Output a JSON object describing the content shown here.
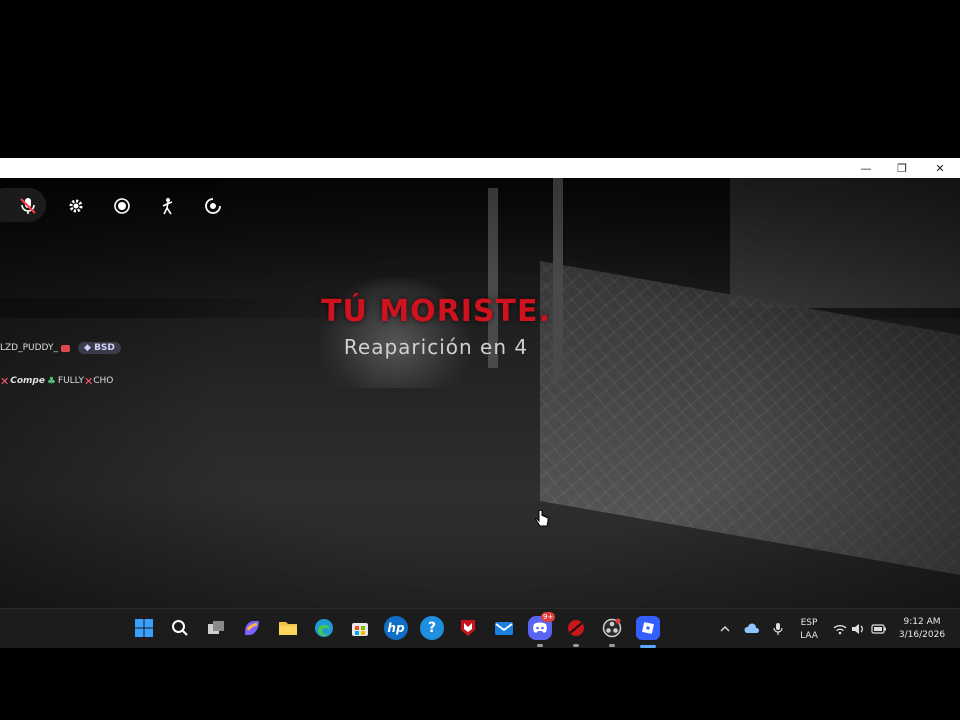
{
  "window": {
    "minimize_glyph": "—",
    "restore_glyph": "❐",
    "close_glyph": "✕"
  },
  "hud": {
    "icons": [
      "microphone-muted-icon",
      "gear-icon",
      "record-icon",
      "emote-icon",
      "backpack-icon"
    ]
  },
  "death_screen": {
    "title": "TÚ MORISTE.",
    "title_color": "#d0121f",
    "respawn_text": "Reaparición en 4"
  },
  "player_tags": [
    {
      "name": "LZD_PUDDY_",
      "badge": "BSD"
    },
    {
      "prefix": "Compe",
      "middle": "FULLY",
      "suffix": "CHO"
    }
  ],
  "taskbar": {
    "apps": [
      "start-icon",
      "search-icon",
      "task-view-icon",
      "copilot-icon",
      "file-explorer-icon",
      "edge-icon",
      "store-icon",
      "hp-icon",
      "help-icon",
      "mcafee-icon",
      "mail-icon",
      "discord-icon",
      "blocked-app-icon",
      "obs-icon",
      "roblox-icon"
    ],
    "discord_badge": "9+",
    "tray": {
      "language_line1": "ESP",
      "language_line2": "LAA",
      "time": "9:12 AM",
      "date": "3/16/2026"
    }
  }
}
